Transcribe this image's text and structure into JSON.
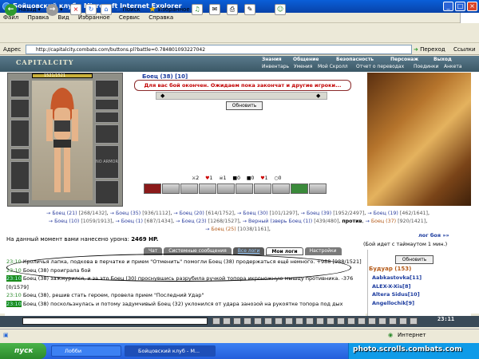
{
  "window": {
    "title": "Бойцовский клуб - Microsoft Internet Explorer"
  },
  "menu": [
    "Файл",
    "Правка",
    "Вид",
    "Избранное",
    "Сервис",
    "Справка"
  ],
  "toolbar": {
    "back": "Назад",
    "search": "Поиск",
    "favorites": "Избранное"
  },
  "address": {
    "label": "Адрес",
    "url": "http://capitalcity.combats.com/buttons.pl?battle=0.784801093227042",
    "go": "Переход",
    "links": "Ссылки"
  },
  "game": {
    "logo": "CAPITALCITY",
    "nav_top": [
      "Знания",
      "Общение",
      "Безопасность",
      "Персонаж",
      "Выход"
    ],
    "nav_bottom": [
      "Инвентарь",
      "Умения",
      "Мой Скролл",
      "Отчет о переводах",
      "Поединки",
      "Анкета"
    ],
    "player_hp": "1521/1521",
    "player_hp_fraction": 1.0,
    "slot_text": "NO ARMOR",
    "enemy_name": "Боец (38) [10]",
    "notice": "Для вас бой окончен. Ожидаем пока закончат и другие игроки...",
    "refresh_button": "Обновить",
    "stats": [
      "2",
      "1",
      "1",
      "0",
      "0",
      "1",
      "0"
    ],
    "teams": {
      "line1": [
        {
          "name": "Боец (21)",
          "hp": "[268/1432]",
          "c": "blue"
        },
        {
          "name": "Боец (35)",
          "hp": "[936/1112]",
          "c": "blue"
        },
        {
          "name": "Боец (20)",
          "hp": "[614/1752]",
          "c": "blue"
        },
        {
          "name": "Боец (30)",
          "hp": "[101/1297]",
          "c": "blue"
        },
        {
          "name": "Боец (39)",
          "hp": "[1952/2497]",
          "c": "blue"
        },
        {
          "name": "Боец (19)",
          "hp": "[462/1641]",
          "c": "blue"
        }
      ],
      "line2": [
        {
          "name": "Боец (10)",
          "hp": "[1059/1913]",
          "c": "blue"
        },
        {
          "name": "Боец (1)",
          "hp": "[687/1434]",
          "c": "blue"
        },
        {
          "name": "Боец (23)",
          "hp": "[1268/1527]",
          "c": "blue"
        },
        {
          "name": "Верный (зверь Боец (1))",
          "hp": "[439/480]",
          "c": "blue"
        },
        {
          "name": "против",
          "hp": "",
          "c": "plain"
        },
        {
          "name": "Боец (37)",
          "hp": "[920/1421]",
          "c": "brown"
        }
      ],
      "line3": [
        {
          "name": "Боец (25)",
          "hp": "[1038/1161]",
          "c": "brown"
        }
      ]
    },
    "damage_text": "На данный момент вами нанесено урона:",
    "damage_value": "2469 HP.",
    "log_title": "лог боя »»",
    "timeout": "(Бой идет с таймаутом 1 мин.)",
    "tabs": [
      "Чат",
      "Системные сообщения",
      "Все логи",
      "Мои логи",
      "Настройки"
    ],
    "chat": [
      {
        "time": "23:10",
        "text": "Кроличья лапка, подкова в перчатке и прием \"Отменить\" помогли Боец (38) продержаться ещё немного. +988 [988/1521]"
      },
      {
        "time": "23:10",
        "text": "Боец (38) проиграла бой"
      },
      {
        "time": "23:10",
        "text": "Боец (38) зажмурился, и за это Боец (30) проснувшись разрубила ручкой топора икроножную мышцу противника. -376 [0/1579]"
      },
      {
        "time": "23:10",
        "text": "Боец (38), решив стать героем, провела прием \"Последний Удар\""
      },
      {
        "time": "23:10",
        "text": "Боец (38) поскользнулась и потому задумчивый Боец (32) уклонился от удара занозой на рукоятке топора под дых"
      }
    ],
    "side_button": "Обновить",
    "side_title": "Будуар (153)",
    "side_list": [
      "Aabkastovka[11]",
      "ALEX-X-Xis[8]",
      "Altera Sidus[10]",
      "Angellochik[9]"
    ],
    "clock": "23:11"
  },
  "status": {
    "zone": "Интернет"
  },
  "taskbar": {
    "start": "пуск",
    "tasks": [
      "Лобби",
      "Бойцовский клуб - M..."
    ]
  },
  "watermark": "photo.scrolls.combats.com"
}
